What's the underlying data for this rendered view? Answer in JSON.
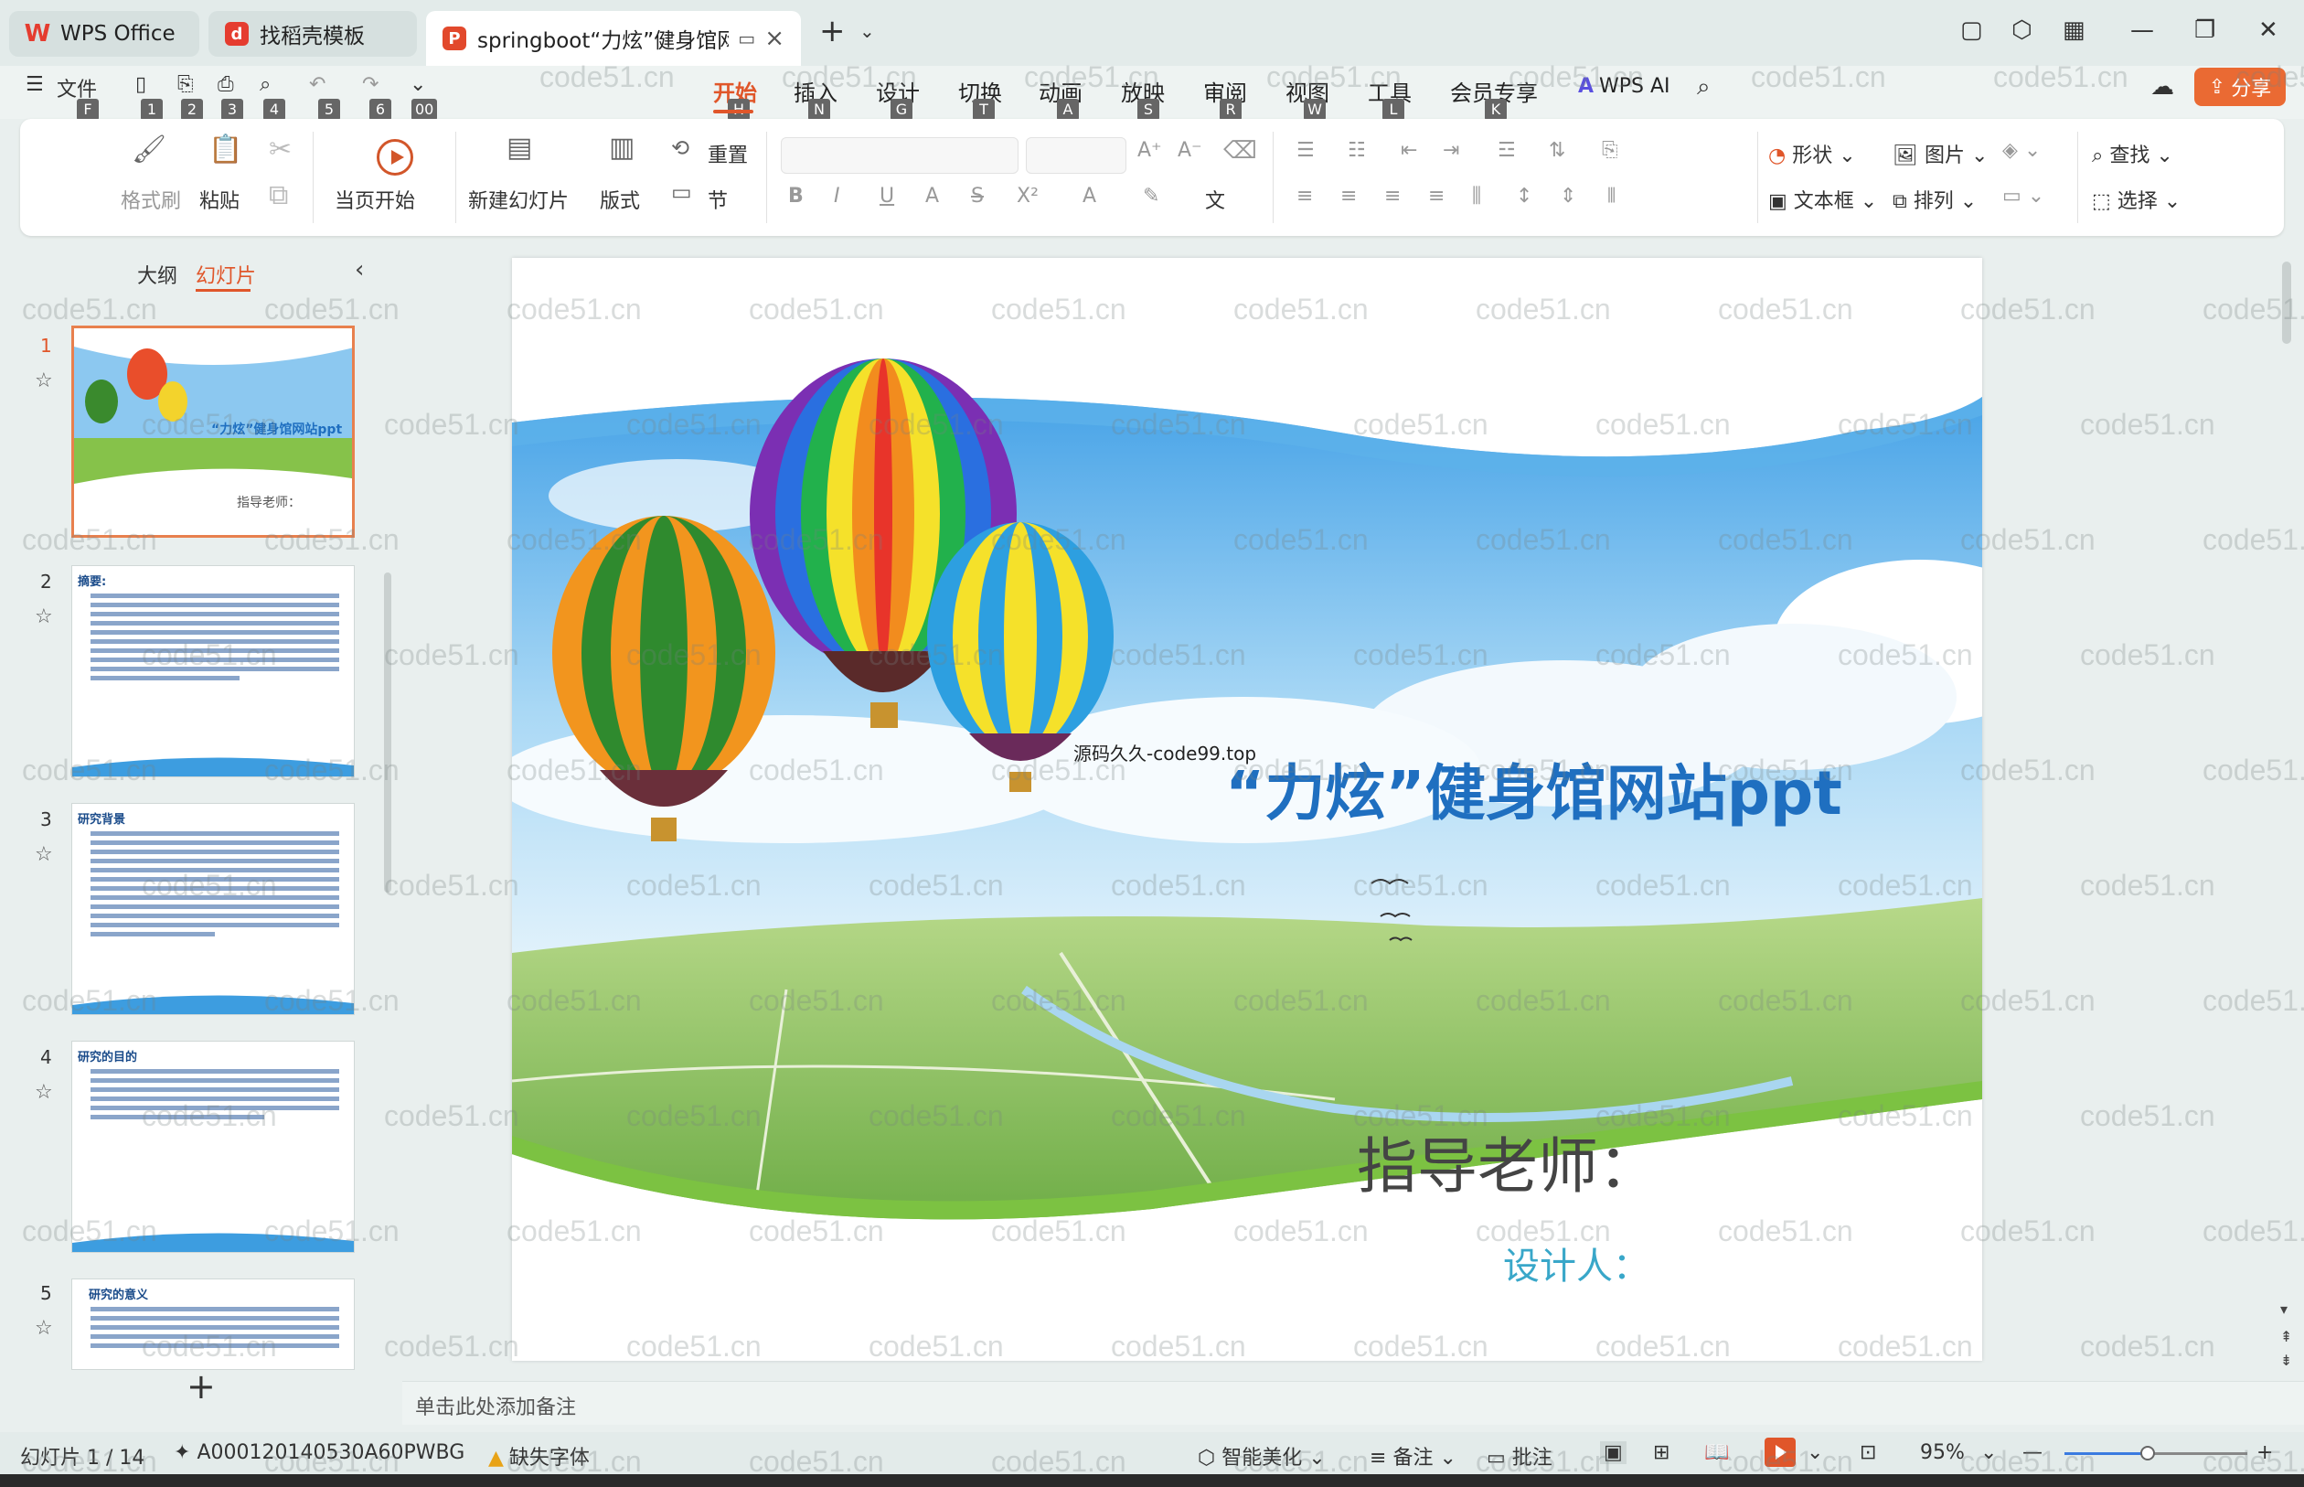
{
  "tabs": [
    {
      "label": "WPS Office",
      "icon": "wps-logo-icon"
    },
    {
      "label": "找稻壳模板",
      "icon": "docer-icon"
    },
    {
      "label": "springboot“力炫”健身馆网",
      "icon": "ppt-file-icon"
    }
  ],
  "menu": {
    "file": "文件",
    "items": [
      "开始",
      "插入",
      "设计",
      "切换",
      "动画",
      "放映",
      "审阅",
      "视图",
      "工具",
      "会员专享"
    ],
    "active_index": 0,
    "keytips": [
      "F",
      "1",
      "2",
      "3",
      "4",
      "5",
      "6",
      "00",
      "H",
      "N",
      "G",
      "T",
      "A",
      "S",
      "R",
      "W",
      "L",
      "K"
    ],
    "wps_ai": "WPS AI",
    "share": "分享"
  },
  "ribbon": {
    "format_painter": "格式刷",
    "paste": "粘贴",
    "play_from_current": "当页开始",
    "new_slide": "新建幻灯片",
    "layout": "版式",
    "reset": "重置",
    "section": "节",
    "shape": "形状",
    "picture": "图片",
    "find": "查找",
    "textbox": "文本框",
    "arrange": "排列",
    "select": "选择"
  },
  "left_panel": {
    "tab_outline": "大纲",
    "tab_slides": "幻灯片",
    "thumbs": [
      {
        "num": "1",
        "title": "“力炫”健身馆网站ppt",
        "teacher": "指导老师："
      },
      {
        "num": "2",
        "title": "摘要:"
      },
      {
        "num": "3",
        "title": "研究背景"
      },
      {
        "num": "4",
        "title": "研究的目的"
      },
      {
        "num": "5",
        "title": "研究的意义"
      }
    ]
  },
  "slide": {
    "title": "“力炫”健身馆网站ppt",
    "source_text": "源码久久-code99.top",
    "teacher": "指导老师：",
    "designer": "设计人："
  },
  "notes": {
    "placeholder": "单击此处添加备注"
  },
  "status": {
    "slide_counter": "幻灯片 1 / 14",
    "doc_id": "A000120140530A60PWBG",
    "missing_fonts": "缺失字体",
    "beautify": "智能美化",
    "notes": "备注",
    "comments": "批注",
    "zoom": "95%",
    "zoom_fraction": 0.95
  },
  "watermark": "code51.cn",
  "colors": {
    "accent": "#e0562a",
    "title_blue": "#1f6fc0",
    "designer_teal": "#39a7c9"
  }
}
